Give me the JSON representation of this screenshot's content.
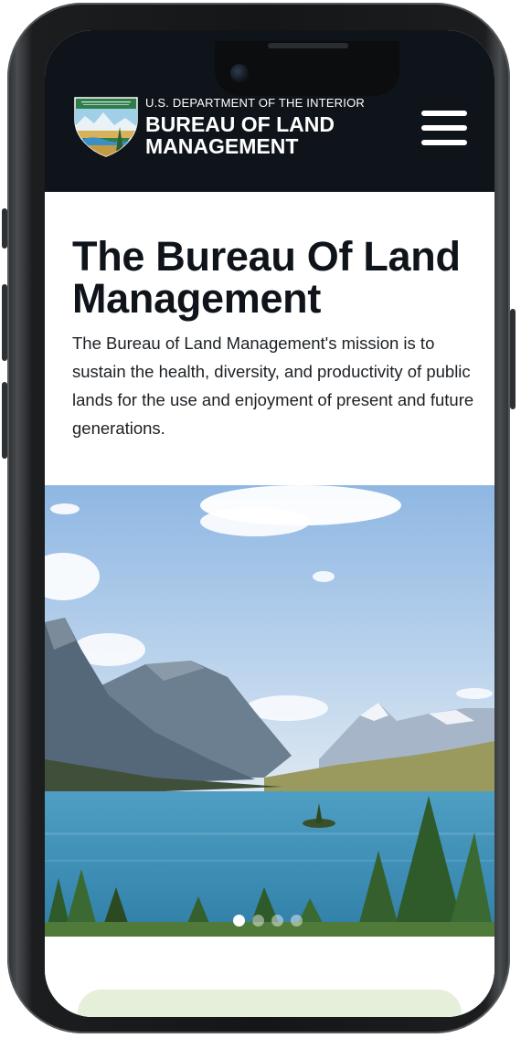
{
  "header": {
    "department": "U.S. DEPARTMENT OF THE INTERIOR",
    "agency_line1": "BUREAU OF LAND",
    "agency_line2": "MANAGEMENT",
    "logo_icon": "blm-shield-logo",
    "menu_icon": "hamburger-menu-icon"
  },
  "main": {
    "title": "The Bureau Of Land Management",
    "mission": "The Bureau of Land Management's mission is to sustain the health, diversity, and productivity of public lands for the use and enjoyment of present and future generations."
  },
  "carousel": {
    "slide_count": 4,
    "active_index": 0
  },
  "colors": {
    "header_bg": "#0e141a",
    "title_text": "#0e141a",
    "next_card_bg": "#e6efd9"
  }
}
